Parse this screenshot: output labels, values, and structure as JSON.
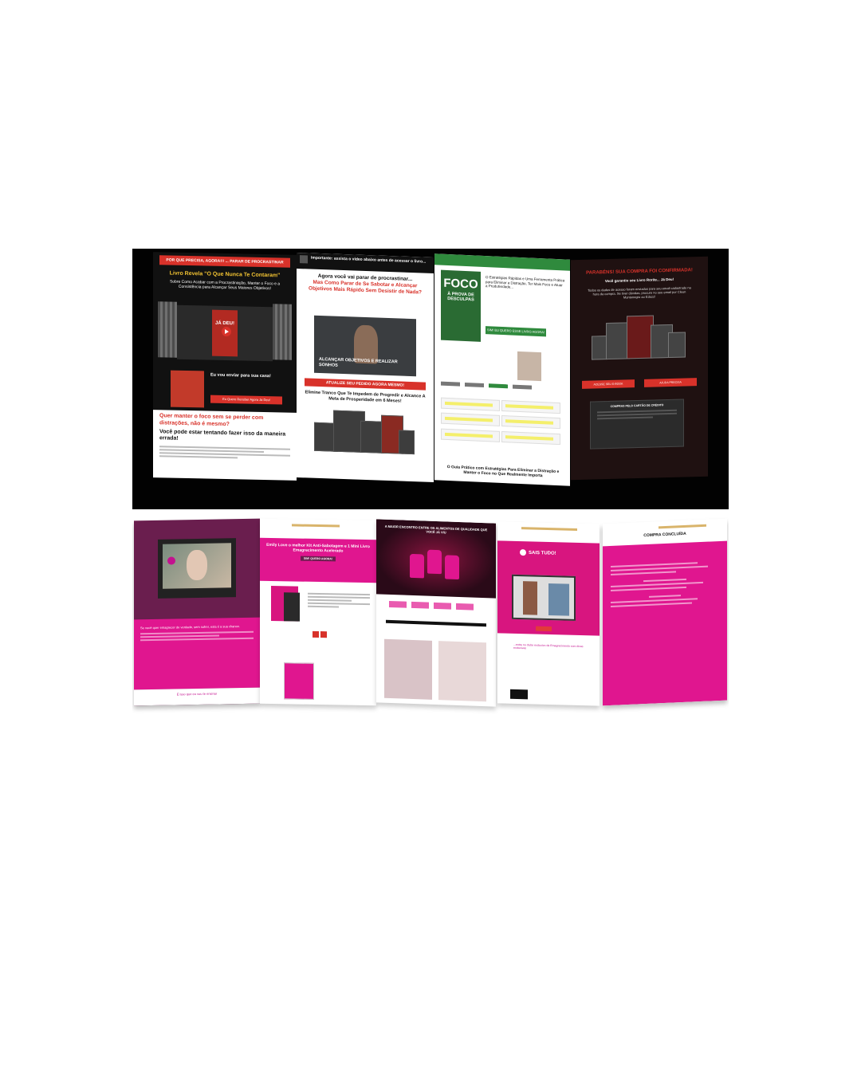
{
  "dark_strip": {
    "p1": {
      "ribbon": "POR QUE PRECISA, AGORA!!! ... PARAR DE PROCRASTINAR",
      "headline_a": "Livro Revela \"O Que Nunca Te Contaram\"",
      "headline_b": "Sobre Como Acabar com a Procrastinação, Manter o Foco e a Consistência para Alcançar Seus Maiores Objetivos!",
      "book_title": "JÁ DEU!",
      "shipping": "Eu vou enviar para sua casa!",
      "cta": "Eu Quero Receber Agora Já Deu!",
      "question": "Quer manter o foco sem se perder com distrações, não é mesmo?",
      "answer": "Você pode estar tentando fazer isso da maneira errada!"
    },
    "p2": {
      "top": "Importante: assista o vídeo abaixo antes de acessar o livro...",
      "headline_a": "Agora você vai parar de procrastinar...",
      "headline_b": "Mas Como Parar de Se Sabotar e Alcançar Objetivos Mais Rápido Sem Desistir de Nada?",
      "video_caption": "ALCANÇAR OBJETIVOS E REALIZAR SONHOS",
      "banner": "ATUALIZE SEU PEDIDO AGORA MESMO!",
      "sub": "Elimine Tranco Que Te Impedem de Progredir e Alcance A Meta de Prosperidade em 6 Meses!"
    },
    "p3": {
      "cover_big": "FOCO",
      "cover_small": "À PROVA DE DESCULPAS",
      "intro": "O Estratégias Rápidas e Uma Ferramenta Prática para Eliminar a Distração, Ter Mais Foco e Atuar a Produtividade...",
      "button": "SIM! EU QUERO ESSE LIVRO AGORA!",
      "footer": "O Guia Prático com Estratégias Para Eliminar a Distração e Manter o Foco no Que Realmente Importa"
    },
    "p4": {
      "headline": "PARABÉNS! SUA COMPRA FOI CONFIRMADA!",
      "sub": "Você garantiu seu Livro Rorite... Já Deu!",
      "text": "Todos os dados de acesso foram enviados para seu email cadastrado na hora da compra. Se tiver dúvidas, procure no seu email por Cleon Montenegro ou Eduzz!",
      "btn_a": "ACESSE SEU E-BOOK",
      "btn_b": "AJUDA PRECISA",
      "card_title": "COMPRAS PELO CARTÃO DE CRÉDITO"
    }
  },
  "pink_strip": {
    "q1": {
      "bottom_text": "Se você quer emagrecer de verdade, sem sofrer, esta é a sua chance.",
      "footer": "É isso que eu vou te ensinar"
    },
    "q2": {
      "headline": "Emily Love o melhor Kit Anti-Sabotagem e 1 Mini Livro Emagrecimento Acelerado",
      "tag": "SIM! QUERO AGORA!"
    },
    "q3": {
      "hero_title": "A MAIOR ENCONTRO ENTRE OS ALIMENTOS DE QUALIDADE QUE VOCÊ JÁ VIU"
    },
    "q4": {
      "logo": "SAIS TUDO!",
      "text": "...entre no clube exclusivo de Emagrecimento com dicas exclusivas"
    },
    "q5": {
      "title": "COMPRA CONCLUÍDA"
    }
  },
  "colors": {
    "red": "#d8322a",
    "green": "#2f8a3d",
    "pink": "#e0168f",
    "plum": "#6a1e4e",
    "gold": "#d9b46b"
  }
}
